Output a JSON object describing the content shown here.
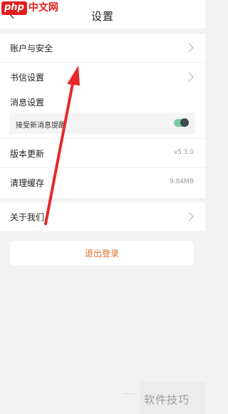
{
  "header": {
    "title": "设置",
    "back_icon": "chevron-left-icon"
  },
  "watermark_top": {
    "badge": "php",
    "text": "中文网"
  },
  "group1": [
    {
      "label": "账户与安全",
      "icon": "chevron-right-icon"
    },
    {
      "label": "书信设置",
      "icon": "chevron-right-icon"
    }
  ],
  "group2": {
    "message_label": "消息设置",
    "toggle_row": {
      "label": "接受新消息提醒",
      "enabled": true
    },
    "version": {
      "label": "版本更新",
      "value": "v5.3.0"
    },
    "cache": {
      "label": "清理缓存",
      "value": "9.84MB"
    }
  },
  "group3": [
    {
      "label": "关于我们",
      "icon": "chevron-right-icon"
    }
  ],
  "logout_label": "退出登录",
  "watermark_bottom": {
    "text": "软件技巧"
  },
  "colors": {
    "accent": "#d96c2c",
    "toggle_on": "#7ec89f",
    "arrow": "#e8282b",
    "watermark_red": "#e41c1c"
  }
}
